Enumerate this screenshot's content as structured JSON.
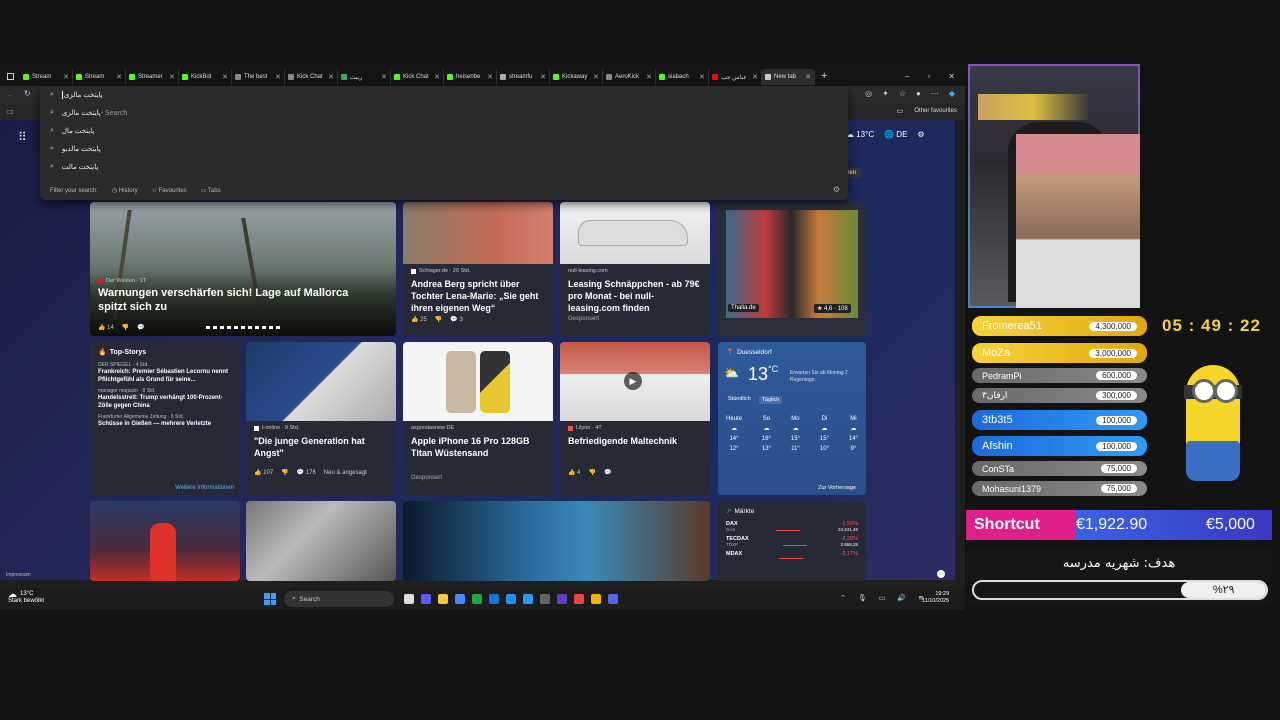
{
  "tabs": [
    {
      "label": "Stream",
      "color": "#53fc18"
    },
    {
      "label": "Stream",
      "color": "#53fc18"
    },
    {
      "label": "Streamer",
      "color": "#53fc18"
    },
    {
      "label": "KickBot",
      "color": "#53fc18"
    },
    {
      "label": "The best",
      "color": "#888"
    },
    {
      "label": "Kick Chat",
      "color": "#888"
    },
    {
      "label": "ربیت",
      "color": "#3a6"
    },
    {
      "label": "Kick Chat",
      "color": "#53fc18"
    },
    {
      "label": "heisenbe",
      "color": "#53fc18"
    },
    {
      "label": "streamfu",
      "color": "#aaa"
    },
    {
      "label": "Kickaway",
      "color": "#53fc18"
    },
    {
      "label": "AeroKick",
      "color": "#888"
    },
    {
      "label": "siabach",
      "color": "#53fc18"
    },
    {
      "label": "عباس جب",
      "color": "#f00"
    },
    {
      "label": "New tab",
      "color": "#ccc"
    }
  ],
  "omnibox": {
    "query": "پایتخت مالزی",
    "suggestions": [
      {
        "text": "پایتخت مالزی",
        "suffix": " - Search"
      },
      {
        "text": "پایتخت مال",
        "suffix": ""
      },
      {
        "text": "پایتخت مالدیو",
        "suffix": ""
      },
      {
        "text": "پایتخت مالت",
        "suffix": ""
      }
    ],
    "filter_label": "Filter your search:",
    "filters": [
      "History",
      "Favourites",
      "Tabs"
    ]
  },
  "favbar": {
    "other": "Other favourites"
  },
  "header": {
    "temp": "13°C",
    "lang": "DE",
    "personalize": "eren"
  },
  "news": [
    {
      "source": "Der Westen · 1T",
      "title": "Warnungen verschärfen sich! Lage auf Mallorca spitzt sich zu",
      "likes": "14"
    },
    {
      "source": "Schlager.de · 20 Std.",
      "title": "Andrea Berg spricht über Tochter Lena-Marie: „Sie geht ihren eigenen Weg“",
      "likes": "25",
      "comments": "3"
    },
    {
      "source": "null-leasing.com",
      "title": "Leasing Schnäppchen - ab 79€ pro Monat - bei null-leasing.com finden",
      "sponsored": "Gesponsert"
    },
    {
      "ad_source": "Thalia.de",
      "rating": "4,6 · 108"
    }
  ],
  "topstories": {
    "title": "Top-Storys",
    "items": [
      {
        "source": "DER SPIEGEL · 4 Std.",
        "title": "Frankreich: Premier Sébastien Lecornu nennt Pflichtgefühl als Grund für seine..."
      },
      {
        "source": "manager magazin · 8 Std.",
        "title": "Handelsstreit: Trump verhängt 100-Prozent-Zölle gegen China"
      },
      {
        "source": "Frankfurter Allgemeine Zeitung · 9 Std.",
        "title": "Schüsse in Gießen — mehrere Verletzte"
      }
    ],
    "more": "Weitere Informationen"
  },
  "row2": [
    {
      "source": "t-online · 9 Std.",
      "title": "\"Die junge Generation hat Angst\"",
      "likes": "107",
      "comments": "176",
      "extra": "Neu & angesagt"
    },
    {
      "source": "asgoodasnew DE",
      "title": "Apple iPhone 16 Pro 128GB Titan Wüstensand",
      "sponsored": "Gesponsert"
    },
    {
      "source": "Lilyon · 4T",
      "title": "Befriedigende Maltechnik",
      "likes": "4"
    }
  ],
  "weather": {
    "city": "Duesseldorf",
    "temp": "13",
    "unit": "°C",
    "note": "Erwarten Sie ab Montag 2 Regentage.",
    "tabs": [
      "Stündlich",
      "Täglich"
    ],
    "days": [
      {
        "d": "Heute",
        "hi": "14°",
        "lo": "12°"
      },
      {
        "d": "So",
        "hi": "16°",
        "lo": "13°"
      },
      {
        "d": "Mo",
        "hi": "15°",
        "lo": "11°"
      },
      {
        "d": "Di",
        "hi": "15°",
        "lo": "10°"
      },
      {
        "d": "Mi",
        "hi": "14°",
        "lo": "9°"
      }
    ],
    "forecast": "Zur Vorhersage"
  },
  "markets": {
    "title": "Märkte",
    "rows": [
      {
        "name": "DAX",
        "sub": "DAX",
        "change": "-1,50%",
        "value": "24.241,46"
      },
      {
        "name": "TECDAX",
        "sub": "TDXP",
        "change": "-2,38%",
        "value": "3.658,28"
      },
      {
        "name": "MDAX",
        "sub": "",
        "change": "-2,17%",
        "value": ""
      }
    ]
  },
  "impressum": "Impressum",
  "taskbar": {
    "weather_temp": "13°C",
    "weather_desc": "Stark bewölkt",
    "search": "Search",
    "time": "19:29",
    "date": "11/10/2025"
  },
  "donations": [
    {
      "name": "Fromerea51",
      "amount": "4,300,000",
      "style": "gold"
    },
    {
      "name": "MoZa",
      "amount": "3,000,000",
      "style": "gold"
    },
    {
      "name": "PedramPi",
      "amount": "600,000",
      "style": "gray"
    },
    {
      "name": "ارفان۳",
      "amount": "300,000",
      "style": "gray"
    },
    {
      "name": "3tb3t5",
      "amount": "100,000",
      "style": "blue"
    },
    {
      "name": "Afshin",
      "amount": "100,000",
      "style": "blue"
    },
    {
      "name": "ConSTa",
      "amount": "75,000",
      "style": "gray"
    },
    {
      "name": "Mohasuni1379",
      "amount": "75,000",
      "style": "gray"
    }
  ],
  "timer": "05 : 49 : 22",
  "shortcut": {
    "label": "Shortcut",
    "current": "€1,922.90",
    "goal": "€5,000"
  },
  "goal": {
    "title": "هدف: شهریه مدرسه",
    "percent_label": "%۲۹",
    "percent": 29
  }
}
